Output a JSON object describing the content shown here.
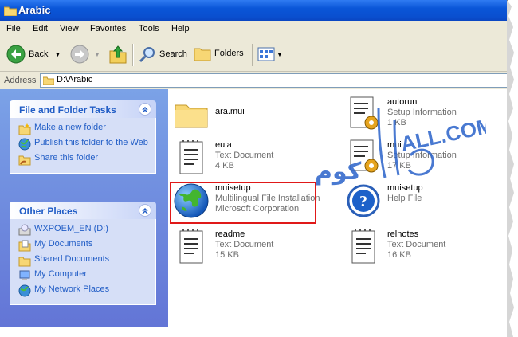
{
  "window": {
    "title": "Arabic"
  },
  "menu": [
    "File",
    "Edit",
    "View",
    "Favorites",
    "Tools",
    "Help"
  ],
  "toolbar": {
    "back": "Back",
    "search": "Search",
    "folders": "Folders"
  },
  "address": {
    "label": "Address",
    "path": "D:\\Arabic"
  },
  "tasks": {
    "title": "File and Folder Tasks",
    "items": [
      "Make a new folder",
      "Publish this folder to the Web",
      "Share this folder"
    ]
  },
  "places": {
    "title": "Other Places",
    "items": [
      "WXPOEM_EN (D:)",
      "My Documents",
      "Shared Documents",
      "My Computer",
      "My Network Places"
    ]
  },
  "files": [
    {
      "name": "ara.mui",
      "line1": "",
      "line2": "",
      "icon": "folder-icon"
    },
    {
      "name": "autorun",
      "line1": "Setup Information",
      "line2": "1 KB",
      "icon": "settings-file-icon"
    },
    {
      "name": "eula",
      "line1": "Text Document",
      "line2": "4 KB",
      "icon": "text-document-icon"
    },
    {
      "name": "mui",
      "line1": "Setup Information",
      "line2": "17 KB",
      "icon": "settings-file-icon"
    },
    {
      "name": "muisetup",
      "line1": "Multilingual File Installation",
      "line2": "Microsoft Corporation",
      "icon": "globe-icon"
    },
    {
      "name": "muisetup",
      "line1": "Help File",
      "line2": "",
      "icon": "help-file-icon"
    },
    {
      "name": "readme",
      "line1": "Text Document",
      "line2": "15 KB",
      "icon": "text-document-icon"
    },
    {
      "name": "relnotes",
      "line1": "Text Document",
      "line2": "16 KB",
      "icon": "text-document-icon"
    }
  ],
  "watermark": {
    "arabic": "كوم",
    "latin": "ALL.COM"
  },
  "colors": {
    "title_bar": "#0a56d8",
    "task_pane": "#6f8fe0",
    "highlight_box": "#e01919"
  }
}
